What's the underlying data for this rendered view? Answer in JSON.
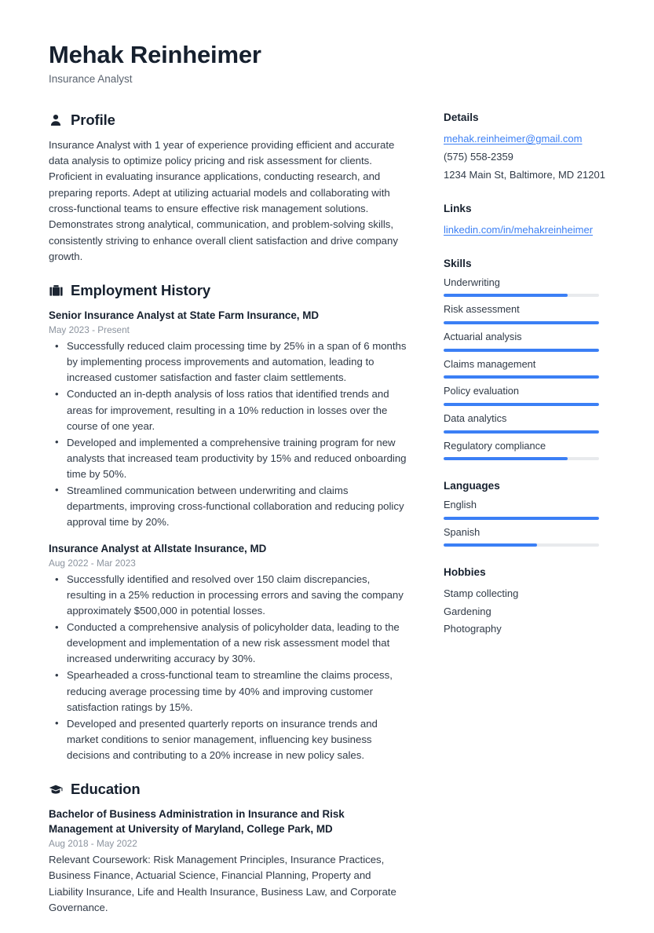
{
  "header": {
    "name": "Mehak Reinheimer",
    "title": "Insurance Analyst"
  },
  "colors": {
    "accent": "#3b7ff5",
    "heading": "#16202e",
    "body": "#303a47",
    "muted": "#8b939e",
    "track": "#e8eaed"
  },
  "sections": {
    "profile": {
      "title": "Profile",
      "icon": "user-icon",
      "text": "Insurance Analyst with 1 year of experience providing efficient and accurate data analysis to optimize policy pricing and risk assessment for clients. Proficient in evaluating insurance applications, conducting research, and preparing reports. Adept at utilizing actuarial models and collaborating with cross-functional teams to ensure effective risk management solutions. Demonstrates strong analytical, communication, and problem-solving skills, consistently striving to enhance overall client satisfaction and drive company growth."
    },
    "employment": {
      "title": "Employment History",
      "icon": "briefcase-icon",
      "entries": [
        {
          "title": "Senior Insurance Analyst at State Farm Insurance, MD",
          "date": "May 2023 - Present",
          "bullets": [
            "Successfully reduced claim processing time by 25% in a span of 6 months by implementing process improvements and automation, leading to increased customer satisfaction and faster claim settlements.",
            "Conducted an in-depth analysis of loss ratios that identified trends and areas for improvement, resulting in a 10% reduction in losses over the course of one year.",
            "Developed and implemented a comprehensive training program for new analysts that increased team productivity by 15% and reduced onboarding time by 50%.",
            "Streamlined communication between underwriting and claims departments, improving cross-functional collaboration and reducing policy approval time by 20%."
          ]
        },
        {
          "title": "Insurance Analyst at Allstate Insurance, MD",
          "date": "Aug 2022 - Mar 2023",
          "bullets": [
            "Successfully identified and resolved over 150 claim discrepancies, resulting in a 25% reduction in processing errors and saving the company approximately $500,000 in potential losses.",
            "Conducted a comprehensive analysis of policyholder data, leading to the development and implementation of a new risk assessment model that increased underwriting accuracy by 30%.",
            "Spearheaded a cross-functional team to streamline the claims process, reducing average processing time by 40% and improving customer satisfaction ratings by 15%.",
            "Developed and presented quarterly reports on insurance trends and market conditions to senior management, influencing key business decisions and contributing to a 20% increase in new policy sales."
          ]
        }
      ]
    },
    "education": {
      "title": "Education",
      "icon": "graduation-cap-icon",
      "entries": [
        {
          "title": "Bachelor of Business Administration in Insurance and Risk Management at University of Maryland, College Park, MD",
          "date": "Aug 2018 - May 2022",
          "description": "Relevant Coursework: Risk Management Principles, Insurance Practices, Business Finance, Actuarial Science, Financial Planning, Property and Liability Insurance, Life and Health Insurance, Business Law, and Corporate Governance."
        }
      ]
    }
  },
  "sidebar": {
    "details": {
      "title": "Details",
      "email": "mehak.reinheimer@gmail.com",
      "phone": "(575) 558-2359",
      "address": "1234 Main St, Baltimore, MD 21201"
    },
    "links": {
      "title": "Links",
      "items": [
        {
          "label": "linkedin.com/in/mehakreinheimer"
        }
      ]
    },
    "skills": {
      "title": "Skills",
      "items": [
        {
          "label": "Underwriting",
          "level": 80
        },
        {
          "label": "Risk assessment",
          "level": 100
        },
        {
          "label": "Actuarial analysis",
          "level": 100
        },
        {
          "label": "Claims management",
          "level": 100
        },
        {
          "label": "Policy evaluation",
          "level": 100
        },
        {
          "label": "Data analytics",
          "level": 100
        },
        {
          "label": "Regulatory compliance",
          "level": 80
        }
      ]
    },
    "languages": {
      "title": "Languages",
      "items": [
        {
          "label": "English",
          "level": 100
        },
        {
          "label": "Spanish",
          "level": 60
        }
      ]
    },
    "hobbies": {
      "title": "Hobbies",
      "items": [
        {
          "label": "Stamp collecting"
        },
        {
          "label": "Gardening"
        },
        {
          "label": "Photography"
        }
      ]
    }
  }
}
